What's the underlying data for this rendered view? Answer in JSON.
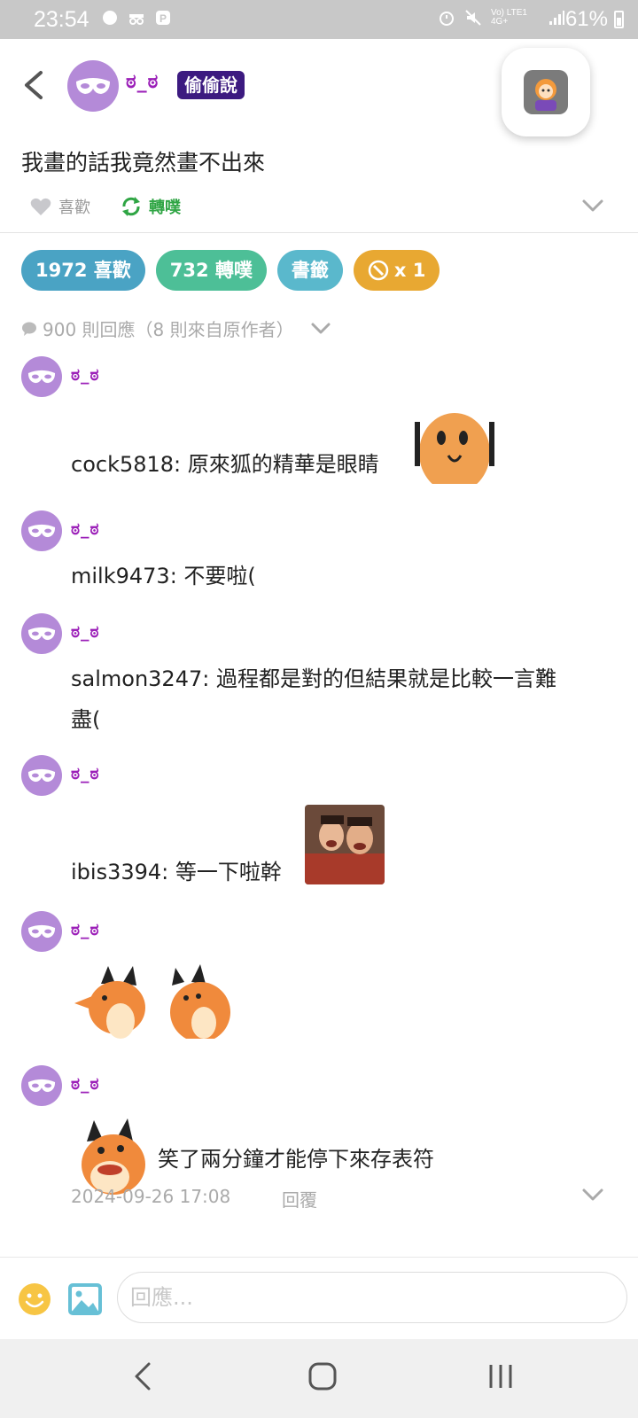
{
  "status_bar": {
    "time": "23:54",
    "battery": "61%",
    "network": "Vo) LTE1 4G+"
  },
  "post": {
    "author": "ಠ_ಠ",
    "badge": "偷偷說",
    "content": "我畫的話我竟然畫不出來",
    "like_label": "喜歡",
    "replurk_label": "轉噗"
  },
  "stats": {
    "likes": "1972 喜歡",
    "replurks": "732 轉噗",
    "bookmark": "書籤",
    "gift": "x 1"
  },
  "responses_header": "900 則回應（8 則來自原作者）",
  "responses": [
    {
      "name": "ಠ_ಠ",
      "text": "cock5818: 原來狐的精華是眼睛",
      "emote": "shiba-sticker"
    },
    {
      "name": "ಠ_ಠ",
      "text": "milk9473: 不要啦("
    },
    {
      "name": "ಠ_ಠ",
      "text_line1": "salmon3247: 過程都是對的但結果就是比較一言難",
      "text_line2": "盡("
    },
    {
      "name": "ಠ_ಠ",
      "text": "ibis3394: 等一下啦幹",
      "emote": "laughing-photo"
    },
    {
      "name": "ಠ_ಠ",
      "emote": "fox-stickers"
    },
    {
      "name": "ಠ_ಠ",
      "text": "笑了兩分鐘才能停下來存表符",
      "emote": "fox-laughing-sticker"
    }
  ],
  "post_meta": {
    "timestamp": "2024-09-26 17:08",
    "reply_label": "回覆"
  },
  "input": {
    "placeholder": "回應..."
  },
  "colors": {
    "likes_pill": "#4aa3c4",
    "replurks_pill": "#4dbf97",
    "bookmark_pill": "#5ab8cc",
    "gift_pill": "#e8a832",
    "nickname": "#9b1fb8",
    "badge_bg": "#3c1a80",
    "avatar": "#b48ad8"
  }
}
